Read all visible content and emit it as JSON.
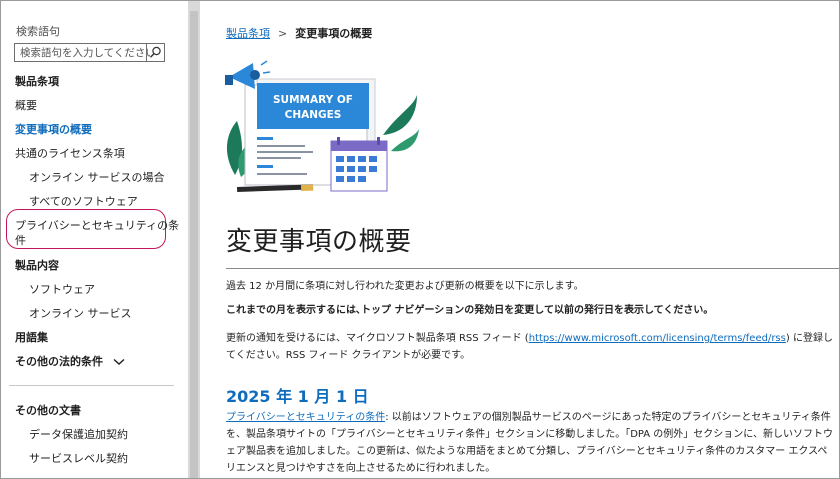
{
  "sidebar": {
    "search_label": "検索語句",
    "search_placeholder": "検索語句を入力してください",
    "items": [
      {
        "label": "製品条項"
      },
      {
        "label": "概要"
      },
      {
        "label": "変更事項の概要"
      },
      {
        "label": "共通のライセンス条項"
      },
      {
        "label": "オンライン サービスの場合"
      },
      {
        "label": "すべてのソフトウェア"
      },
      {
        "label": "プライバシーとセキュリティの条"
      },
      {
        "label": "件"
      },
      {
        "label": "製品内容"
      },
      {
        "label": "ソフトウェア"
      },
      {
        "label": "オンライン サービス"
      },
      {
        "label": "用語集"
      },
      {
        "label": "その他の法的条件"
      },
      {
        "label": "その他の文書"
      },
      {
        "label": "データ保護追加契約"
      },
      {
        "label": "サービスレベル契約"
      }
    ]
  },
  "breadcrumb": {
    "link": "製品条項",
    "separator": ">",
    "current": "変更事項の概要"
  },
  "hero": {
    "line1": "SUMMARY OF",
    "line2": "CHANGES"
  },
  "main": {
    "title": "変更事項の概要",
    "intro": "過去 12 か月間に条項に対し行われた変更および更新の概要を以下に示します。",
    "instruction": "これまでの月を表示するには､トップ ナビゲーションの発効日を変更して以前の発行日を表示してください｡",
    "rss_before": "更新の通知を受けるには、マイクロソフト製品条項 RSS フィード (",
    "rss_link": "https://www.microsoft.com/licensing/terms/feed/rss",
    "rss_after": ") に登録してください。RSS フィード クライアントが必要です。",
    "date_heading": "2025 年 1 月 1 日",
    "update_link": "プライバシーとセキュリティの条件",
    "update_text": ": 以前はソフトウェアの個別製品サービスのページにあった特定のプライバシーとセキュリティ条件を、製品条項サイトの「プライバシーとセキュリティ条件」セクションに移動しました。「DPA の例外」セクションに、新しいソフトウェア製品表を追加しました。この更新は、似たような用語をまとめて分類し、プライバシーとセキュリティ条件のカスタマー エクスペリエンスと見つけやすさを向上させるために行われました。"
  },
  "colors": {
    "link": "#0f6cbd",
    "highlight": "#c2185b",
    "card_blue": "#2b88d8",
    "calendar_purple": "#7b6bc7"
  }
}
